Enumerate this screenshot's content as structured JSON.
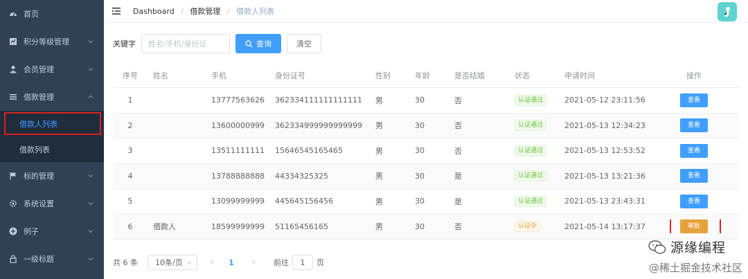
{
  "sidebar": {
    "items": [
      {
        "label": "首页"
      },
      {
        "label": "积分等级管理"
      },
      {
        "label": "会员管理"
      },
      {
        "label": "借款管理"
      },
      {
        "label": "标的管理"
      },
      {
        "label": "系统设置"
      },
      {
        "label": "例子"
      },
      {
        "label": "一级标题"
      }
    ],
    "submenu": [
      {
        "label": "借款人列表"
      },
      {
        "label": "借款列表"
      }
    ]
  },
  "navbar": {
    "breadcrumb": [
      "Dashboard",
      "借款管理",
      "借款人列表"
    ],
    "separator": "/"
  },
  "search": {
    "keyword_label": "关键字",
    "placeholder": "姓名/手机/身份证",
    "query_label": "查询",
    "clear_label": "清空"
  },
  "table": {
    "headers": [
      "序号",
      "姓名",
      "手机",
      "身份证号",
      "性别",
      "年龄",
      "是否结婚",
      "状态",
      "申请时间",
      "操作"
    ],
    "rows": [
      {
        "idx": "1",
        "name": "",
        "phone": "13777563626",
        "id": "362334111111111111",
        "sex": "男",
        "age": "30",
        "married": "否",
        "status": "认证通过",
        "time": "2021-05-12 23:11:56",
        "op": "查看"
      },
      {
        "idx": "2",
        "name": "",
        "phone": "13600000999",
        "id": "362334999999999999",
        "sex": "男",
        "age": "30",
        "married": "否",
        "status": "认证通过",
        "time": "2021-05-13 12:34:23",
        "op": "查看"
      },
      {
        "idx": "3",
        "name": "",
        "phone": "13511111111",
        "id": "15646545165465",
        "sex": "男",
        "age": "30",
        "married": "否",
        "status": "认证通过",
        "time": "2021-05-13 12:53:52",
        "op": "查看"
      },
      {
        "idx": "4",
        "name": "",
        "phone": "13788888888",
        "id": "44334325325",
        "sex": "男",
        "age": "30",
        "married": "是",
        "status": "认证通过",
        "time": "2021-05-13 13:21:36",
        "op": "查看"
      },
      {
        "idx": "5",
        "name": "",
        "phone": "13099999999",
        "id": "445645156456",
        "sex": "男",
        "age": "30",
        "married": "是",
        "status": "认证通过",
        "time": "2021-05-13 23:43:31",
        "op": "查看"
      },
      {
        "idx": "6",
        "name": "借款人",
        "phone": "18599999999",
        "id": "51165456165",
        "sex": "男",
        "age": "30",
        "married": "否",
        "status": "认证中",
        "time": "2021-05-14 13:17:37",
        "op": "审批"
      }
    ]
  },
  "pagination": {
    "total": "共 6 条",
    "page_size": "10条/页",
    "current_page": "1",
    "goto_label": "前往",
    "goto_value": "1",
    "page_suffix": "页"
  },
  "watermark": {
    "line1": "源缘编程",
    "line2": "@稀土掘金技术社区"
  },
  "colors": {
    "sidebar_bg": "#304156",
    "primary": "#409eff",
    "warning": "#e6a23c",
    "success": "#67c23a",
    "highlight": "#e02020"
  }
}
